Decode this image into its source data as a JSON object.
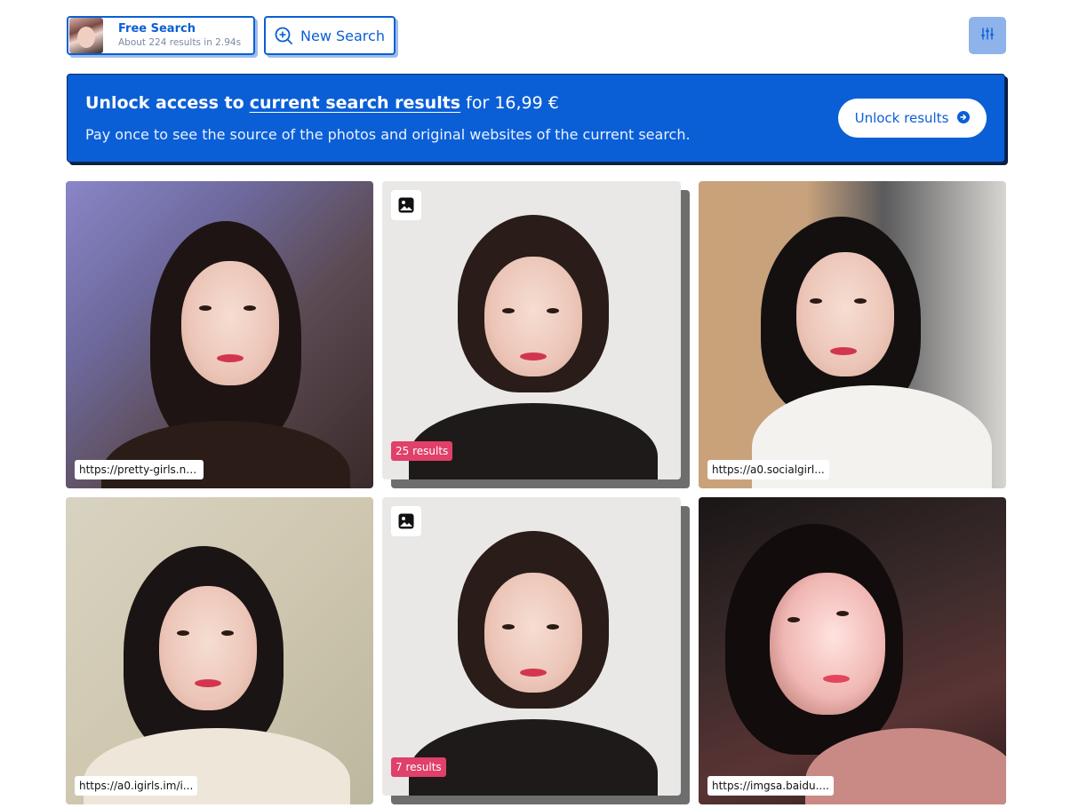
{
  "header": {
    "search_card": {
      "title": "Free Search",
      "subtitle": "About 224 results in 2.94s"
    },
    "new_search_label": "New Search"
  },
  "banner": {
    "title_prefix": "Unlock access to",
    "title_link": "current search results",
    "title_suffix": "for 16,99 €",
    "subtitle": "Pay once to see the source of the photos and original websites of the current search.",
    "button_label": "Unlock results"
  },
  "results": [
    {
      "url": "https://pretty-girls.net/"
    },
    {
      "results_count": "25 results"
    },
    {
      "url": "https://a0.socialgirl..."
    },
    {
      "url": "https://a0.igirls.im/i..."
    },
    {
      "results_count": "7 results"
    },
    {
      "url": "https://imgsa.baidu...."
    }
  ],
  "colors": {
    "primary": "#0b5fd6",
    "badge": "#e0406a",
    "filter_button": "#8db3ea"
  }
}
